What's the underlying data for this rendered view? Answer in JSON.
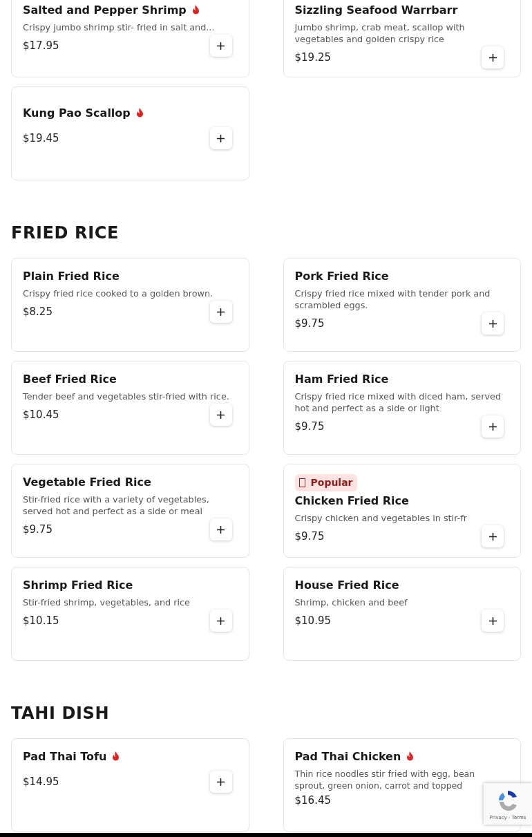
{
  "sections": [
    {
      "items": [
        {
          "name": "Salted and Pepper Shrimp",
          "spicy": true,
          "description": "Crispy jumbo shrimp stir- fried in salt and...",
          "price": "$17.95"
        },
        {
          "name": "Sizzling Seafood Warrbarr",
          "spicy": false,
          "description": "Jumbo shrimp, crab meat, scallop with vegetables and golden crispy rice",
          "price": "$19.25"
        },
        {
          "name": "Kung Pao Scallop",
          "spicy": true,
          "price": "$19.45"
        }
      ]
    },
    {
      "title": "FRIED RICE",
      "items": [
        {
          "name": "Plain Fried Rice",
          "spicy": false,
          "description": "Crispy fried rice cooked to a golden brown.",
          "price": "$8.25"
        },
        {
          "name": "Pork Fried Rice",
          "spicy": false,
          "description": "Crispy fried rice mixed with tender pork and scrambled eggs.",
          "price": "$9.75"
        },
        {
          "name": "Beef Fried Rice",
          "spicy": false,
          "description": "Tender beef and vegetables stir-fried with rice.",
          "price": "$10.45"
        },
        {
          "name": "Ham Fried Rice",
          "spicy": false,
          "description": "Crispy fried rice mixed with diced ham, served hot and perfect as a side or light",
          "price": "$9.75"
        },
        {
          "name": "Vegetable Fried Rice",
          "spicy": false,
          "description": "Stir-fried rice with a variety of vegetables, served hot and perfect as a side or meal",
          "price": "$9.75"
        },
        {
          "name": "Chicken Fried Rice",
          "spicy": false,
          "badge": "Popular",
          "description": "Crispy chicken and vegetables in stir-fr",
          "price": "$9.75"
        },
        {
          "name": "Shrimp Fried Rice",
          "spicy": false,
          "description": "Stir-fried shrimp, vegetables, and rice",
          "price": "$10.15"
        },
        {
          "name": "House Fried Rice",
          "spicy": false,
          "description": "Shrimp, chicken and beef",
          "price": "$10.95"
        }
      ]
    },
    {
      "title": "TAHI DISH",
      "items": [
        {
          "name": "Pad Thai Tofu",
          "spicy": true,
          "price": "$14.95"
        },
        {
          "name": "Pad Thai Chicken",
          "spicy": true,
          "covered": true,
          "description": "Thin rice noodles stir fried with egg, bean sprout, green onion, carrot and topped",
          "price": "$16.45"
        }
      ]
    }
  ],
  "recaptcha": {
    "links": "Privacy - Terms"
  }
}
